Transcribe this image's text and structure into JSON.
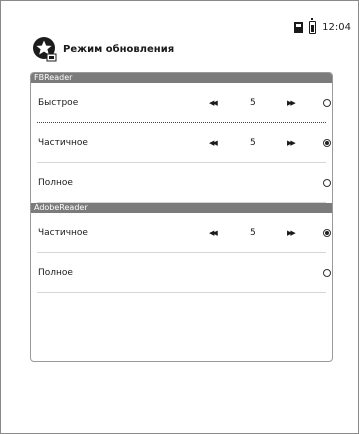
{
  "status": {
    "time": "12:04",
    "icons": [
      "storage-icon",
      "battery-icon"
    ]
  },
  "header": {
    "title": "Режим обновления",
    "icon": "refresh-mode-icon"
  },
  "sections": [
    {
      "name": "FBReader",
      "rows": [
        {
          "label": "Быстрое",
          "value": "5",
          "has_stepper": true,
          "selected": false,
          "separator": "dotted"
        },
        {
          "label": "Частичное",
          "value": "5",
          "has_stepper": true,
          "selected": true,
          "separator": "solid"
        },
        {
          "label": "Полное",
          "value": "",
          "has_stepper": false,
          "selected": false,
          "separator": "solid"
        }
      ]
    },
    {
      "name": "AdobeReader",
      "rows": [
        {
          "label": "Частичное",
          "value": "5",
          "has_stepper": true,
          "selected": true,
          "separator": "solid"
        },
        {
          "label": "Полное",
          "value": "",
          "has_stepper": false,
          "selected": false,
          "separator": "solid"
        }
      ]
    }
  ],
  "controls": {
    "decrease_glyph": "◀◀",
    "increase_glyph": "▶▶"
  }
}
